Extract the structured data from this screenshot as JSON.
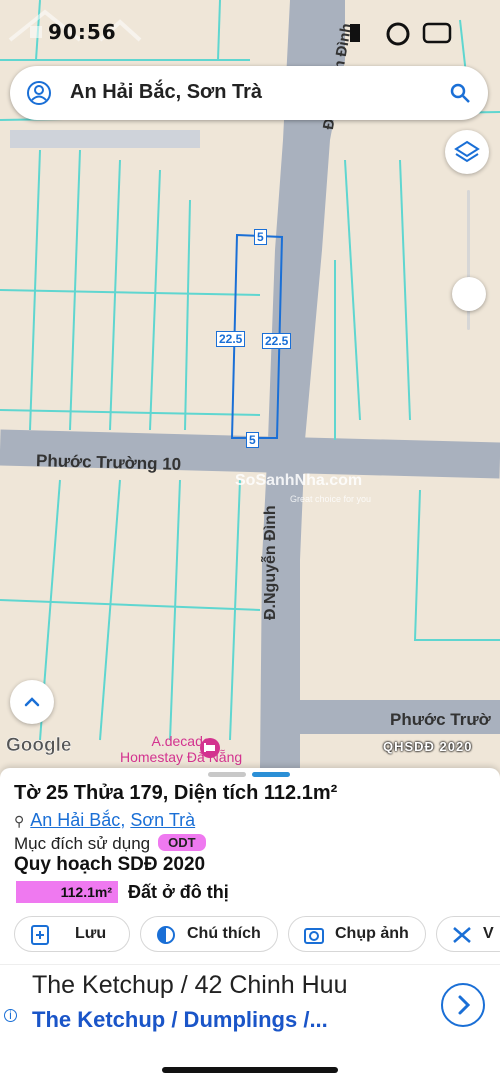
{
  "status_bar": {
    "time": "90:56"
  },
  "search": {
    "query": "An Hải Bắc, Sơn Trà"
  },
  "map": {
    "roads": {
      "nguyen_dinh_top": "Đ.Nguyễn Đình",
      "nguyen_dinh_mid": "Đ.Nguyễn Đình",
      "phuoc_truong_10": "Phước Trường 10",
      "phuoc_truong_right": "Phước Trườ"
    },
    "dimensions": {
      "top": "5",
      "bottom": "5",
      "left": "22.5",
      "right": "22.5"
    },
    "watermark": "SoSanhNha.com",
    "watermark_sub": "Great choice for you",
    "attribution": "Google",
    "poi": {
      "line1": "A.decade",
      "line2": "Homestay Đà Nẵng"
    },
    "layer_tag": "QHSDĐ 2020"
  },
  "sheet": {
    "title": "Tờ 25 Thửa 179, Diện tích 112.1m²",
    "ward": "An Hải Bắc",
    "district": "Sơn Trà",
    "purpose_label": "Mục đích sử dụng",
    "purpose_code": "ODT",
    "plan_title": "Quy hoạch SDĐ 2020",
    "plan_area": "112.1m²",
    "plan_land_type": "Đất ở đô thị",
    "actions": [
      {
        "label": "Lưu",
        "icon": "add-box-icon"
      },
      {
        "label": "Chú thích",
        "icon": "contrast-icon"
      },
      {
        "label": "Chụp ảnh",
        "icon": "camera-icon"
      },
      {
        "label": "V",
        "icon": "tools-icon"
      }
    ]
  },
  "ad": {
    "title": "The Ketchup / 42 Chinh Huu",
    "subtitle": "The Ketchup / Dumplings /..."
  },
  "colors": {
    "accent": "#1a6fd6",
    "pink": "#ef79f0",
    "map_bg": "#efe6d8",
    "road": "#a8b0bd",
    "parcel": "#5fd6d0"
  }
}
